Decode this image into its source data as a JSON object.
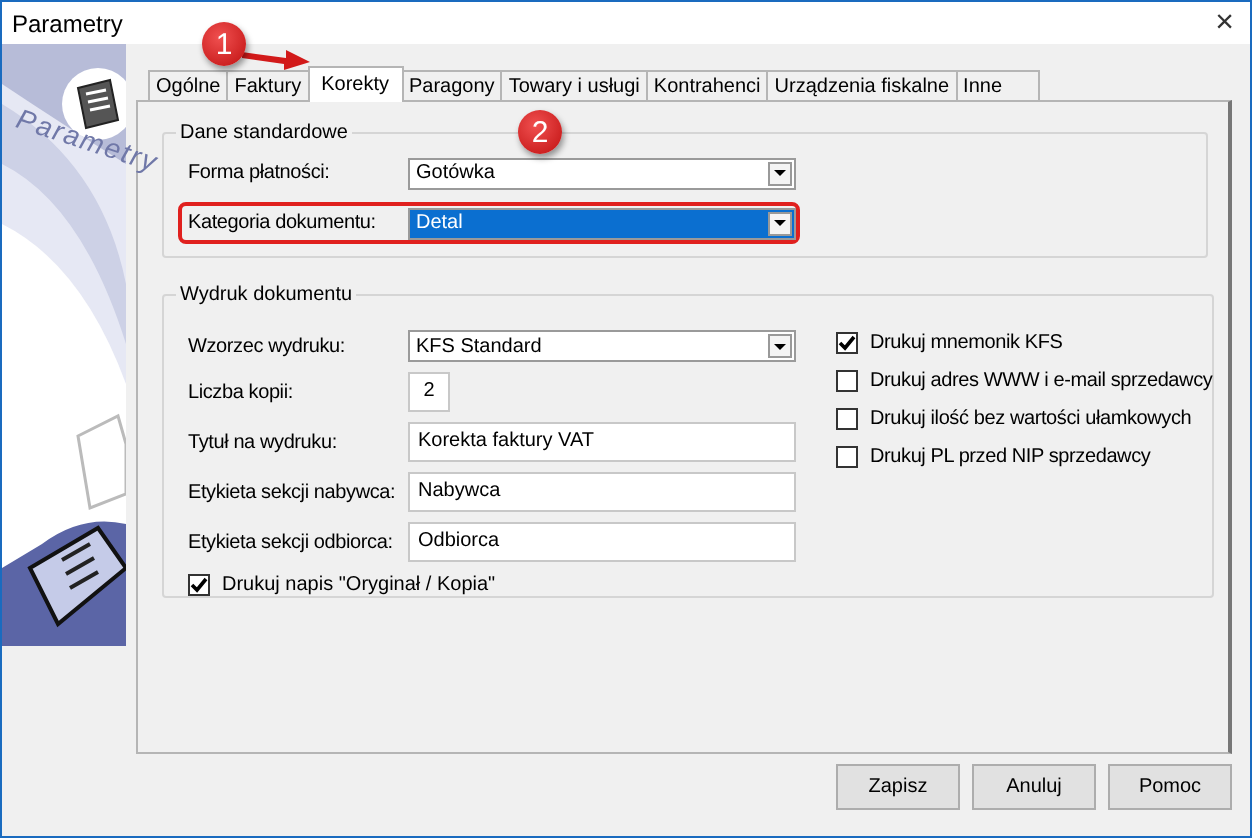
{
  "window": {
    "title": "Parametry",
    "close": "×"
  },
  "sidebar": {
    "caption": "Parametry"
  },
  "tabs": [
    {
      "label": "Ogólne",
      "selected": false
    },
    {
      "label": "Faktury",
      "selected": false
    },
    {
      "label": "Korekty",
      "selected": true
    },
    {
      "label": "Paragony",
      "selected": false
    },
    {
      "label": "Towary i usługi",
      "selected": false
    },
    {
      "label": "Kontrahenci",
      "selected": false
    },
    {
      "label": "Urządzenia fiskalne",
      "selected": false
    },
    {
      "label": "Inne",
      "selected": false
    }
  ],
  "standard": {
    "title": "Dane standardowe",
    "fields": [
      {
        "label": "Forma płatności:",
        "value": "Gotówka",
        "selected": false,
        "highlighted": false
      },
      {
        "label": "Kategoria dokumentu:",
        "value": "Detal",
        "selected": true,
        "highlighted": true
      }
    ]
  },
  "print": {
    "title": "Wydruk dokumentu",
    "fields": [
      {
        "kind": "combo",
        "label": "Wzorzec wydruku:",
        "value": "KFS Standard"
      },
      {
        "kind": "number",
        "label": "Liczba kopii:",
        "value": "2"
      },
      {
        "kind": "text",
        "label": "Tytuł na wydruku:",
        "value": "Korekta faktury VAT"
      },
      {
        "kind": "text",
        "label": "Etykieta sekcji nabywca:",
        "value": "Nabywca"
      },
      {
        "kind": "text",
        "label": "Etykieta sekcji odbiorca:",
        "value": "Odbiorca"
      }
    ],
    "bottom_option": {
      "label": "Drukuj napis \"Oryginał / Kopia\"",
      "checked": true
    },
    "options": [
      {
        "label": "Drukuj mnemonik KFS",
        "checked": true
      },
      {
        "label": "Drukuj adres WWW i e-mail sprzedawcy",
        "checked": false
      },
      {
        "label": "Drukuj ilość bez wartości ułamkowych",
        "checked": false
      },
      {
        "label": "Drukuj PL przed NIP sprzedawcy",
        "checked": false
      }
    ]
  },
  "annotations": [
    {
      "label": "1"
    },
    {
      "label": "2"
    }
  ],
  "buttons": [
    "Zapisz",
    "Anuluj",
    "Pomoc"
  ]
}
